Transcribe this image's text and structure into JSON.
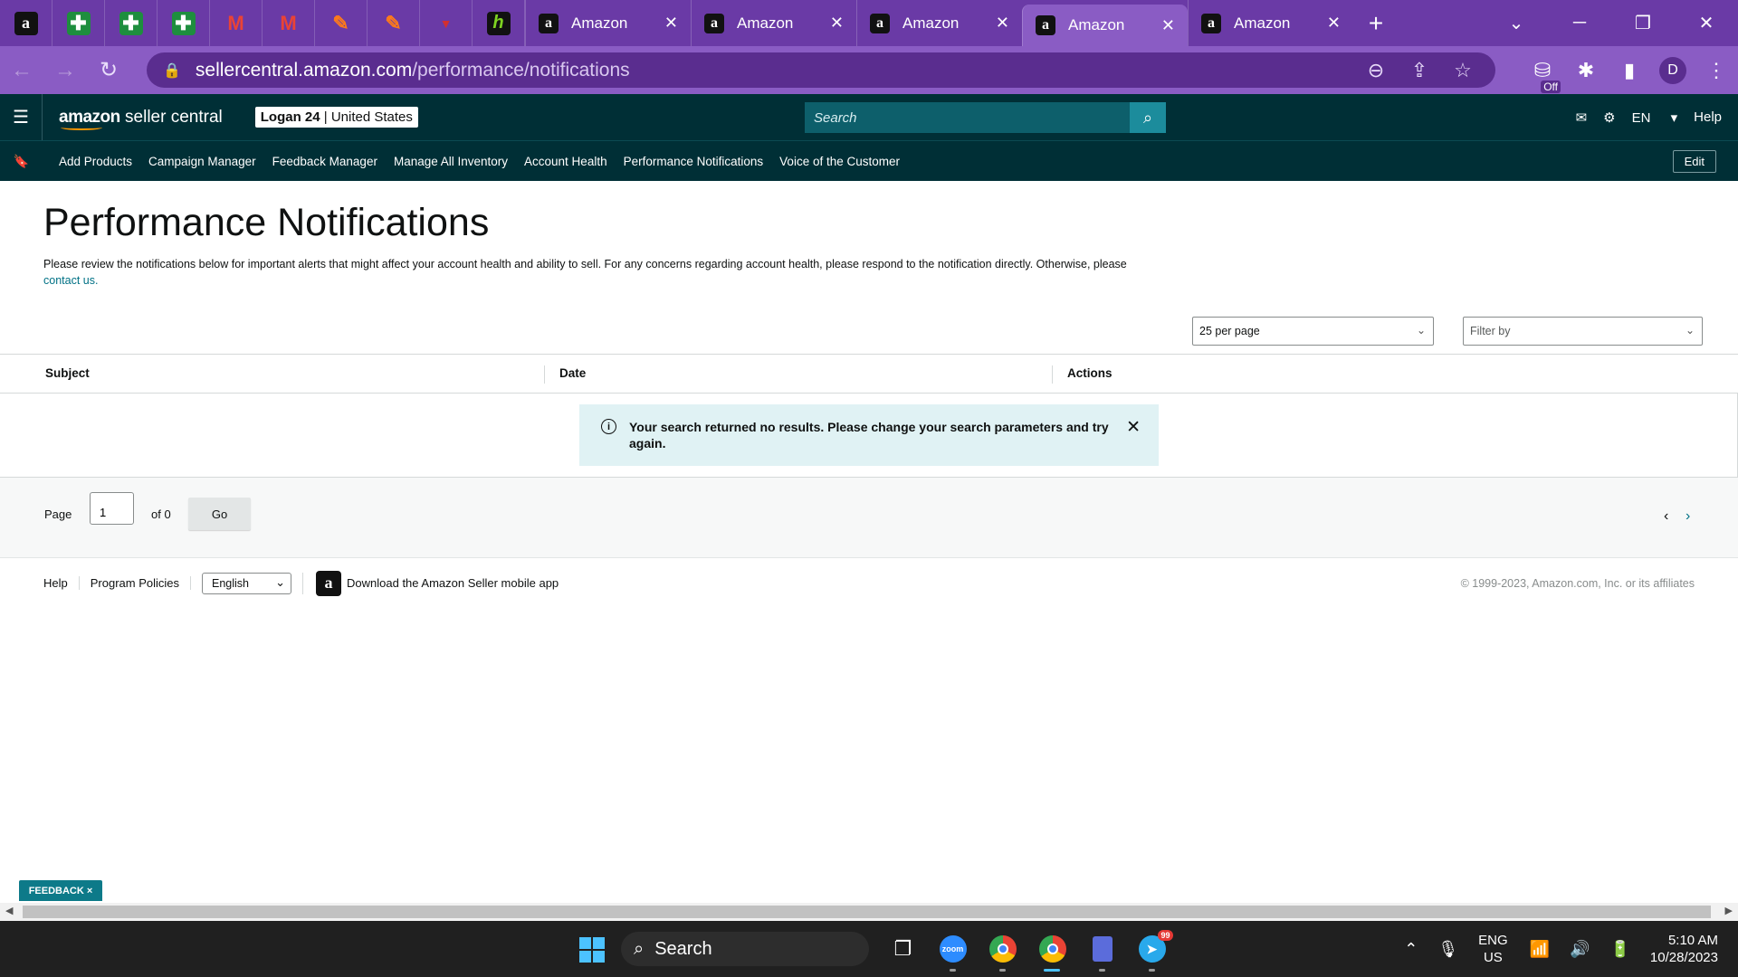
{
  "browser": {
    "pinned_tabs": [
      {
        "icon": "amazon-icon",
        "glyph": "a"
      },
      {
        "icon": "sheets-icon",
        "glyph": "✚"
      },
      {
        "icon": "sheets-icon",
        "glyph": "✚"
      },
      {
        "icon": "sheets-icon",
        "glyph": "✚"
      },
      {
        "icon": "gmail-icon",
        "glyph": "M"
      },
      {
        "icon": "gmail-icon",
        "glyph": "M"
      },
      {
        "icon": "orange-app-icon",
        "glyph": "✎"
      },
      {
        "icon": "orange-app-icon",
        "glyph": "✎"
      },
      {
        "icon": "red-app-icon",
        "glyph": "▼"
      },
      {
        "icon": "green-app-icon",
        "glyph": "h"
      }
    ],
    "tabs": [
      {
        "title": "Amazon",
        "active": false
      },
      {
        "title": "Amazon",
        "active": false
      },
      {
        "title": "Amazon",
        "active": false
      },
      {
        "title": "Amazon",
        "active": true
      },
      {
        "title": "Amazon",
        "active": false
      }
    ],
    "url_host": "sellercentral.amazon.com",
    "url_path": "/performance/notifications",
    "profile_initial": "D",
    "extension_badge": "Off"
  },
  "header": {
    "logo_bold": "amazon",
    "logo_rest": " seller central",
    "store_name": "Logan 24",
    "store_region": "United States",
    "search_placeholder": "Search",
    "language": "EN",
    "help": "Help"
  },
  "shortcuts": {
    "items": [
      "Add Products",
      "Campaign Manager",
      "Feedback Manager",
      "Manage All Inventory",
      "Account Health",
      "Performance Notifications",
      "Voice of the Customer"
    ],
    "edit": "Edit"
  },
  "page": {
    "title": "Performance Notifications",
    "intro_text": "Please review the notifications below for important alerts that might affect your account health and ability to sell. For any concerns regarding account health, please respond to the notification directly. Otherwise, please ",
    "intro_link": "contact us.",
    "per_page": "25 per page",
    "filter_placeholder": "Filter by",
    "columns": [
      "Subject",
      "Date",
      "Actions"
    ],
    "alert_message": "Your search returned no results. Please change your search parameters and try again.",
    "pager": {
      "label": "Page",
      "current": "1",
      "of": "of 0",
      "go": "Go"
    }
  },
  "footer": {
    "links": [
      "Help",
      "Program Policies"
    ],
    "language": "English",
    "app_download": "Download the Amazon Seller mobile app",
    "copyright": "© 1999-2023, Amazon.com, Inc. or its affiliates"
  },
  "feedback": {
    "label": "FEEDBACK",
    "close": "×"
  },
  "taskbar": {
    "search": "Search",
    "lang_line1": "ENG",
    "lang_line2": "US",
    "time": "5:10 AM",
    "date": "10/28/2023",
    "telegram_badge": "99",
    "zoom_label": "zoom"
  },
  "colors": {
    "browser_frame": "#6a3aa6",
    "seller_header": "#002f36",
    "link": "#007185",
    "alert_bg": "#e0f2f4"
  }
}
